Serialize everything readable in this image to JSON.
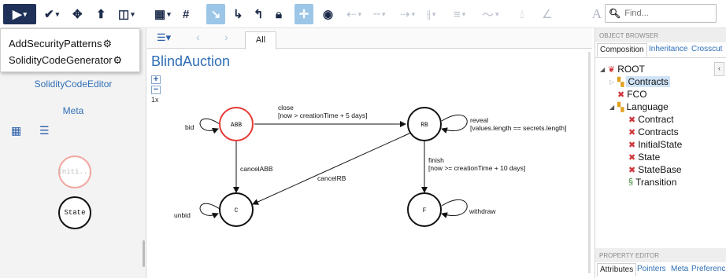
{
  "toolbar": {
    "find_placeholder": "Find..."
  },
  "menu": {
    "items": [
      "AddSecurityPatterns",
      "SolidityCodeGenerator"
    ]
  },
  "left": {
    "links": [
      "SolidityCodeEditor",
      "Meta"
    ],
    "palette": [
      "Initi...",
      "State"
    ]
  },
  "center": {
    "tab_all": "All",
    "title": "BlindAuction",
    "zoom_label": "1x",
    "states": [
      "ABB",
      "RB",
      "C",
      "F"
    ],
    "edge_labels": {
      "bid": "bid",
      "close_1": "close",
      "close_2": "[now > creationTime + 5 days]",
      "reveal_1": "reveal",
      "reveal_2": "[values.length == secrets.length]",
      "cancelABB": "cancelABB",
      "cancelRB": "cancelRB",
      "finish_1": "finish",
      "finish_2": "[now >= creationTime + 10 days]",
      "unbid": "unbid",
      "withdraw": "withdraw"
    }
  },
  "right": {
    "object_browser": "OBJECT BROWSER",
    "tabs": [
      "Composition",
      "Inheritance",
      "Crosscut"
    ],
    "tree": [
      "ROOT",
      "Contracts",
      "FCO",
      "Language",
      "Contract",
      "Contracts",
      "InitialState",
      "State",
      "StateBase",
      "Transition"
    ],
    "property_editor": "PROPERTY EDITOR",
    "prop_tabs": [
      "Attributes",
      "Pointers",
      "Meta",
      "Preferenc"
    ]
  },
  "colors": {
    "navy": "#1f3158",
    "link": "#2f6fb6",
    "abb_border": "#e53935",
    "palette_initial": "#f4a6a0"
  }
}
